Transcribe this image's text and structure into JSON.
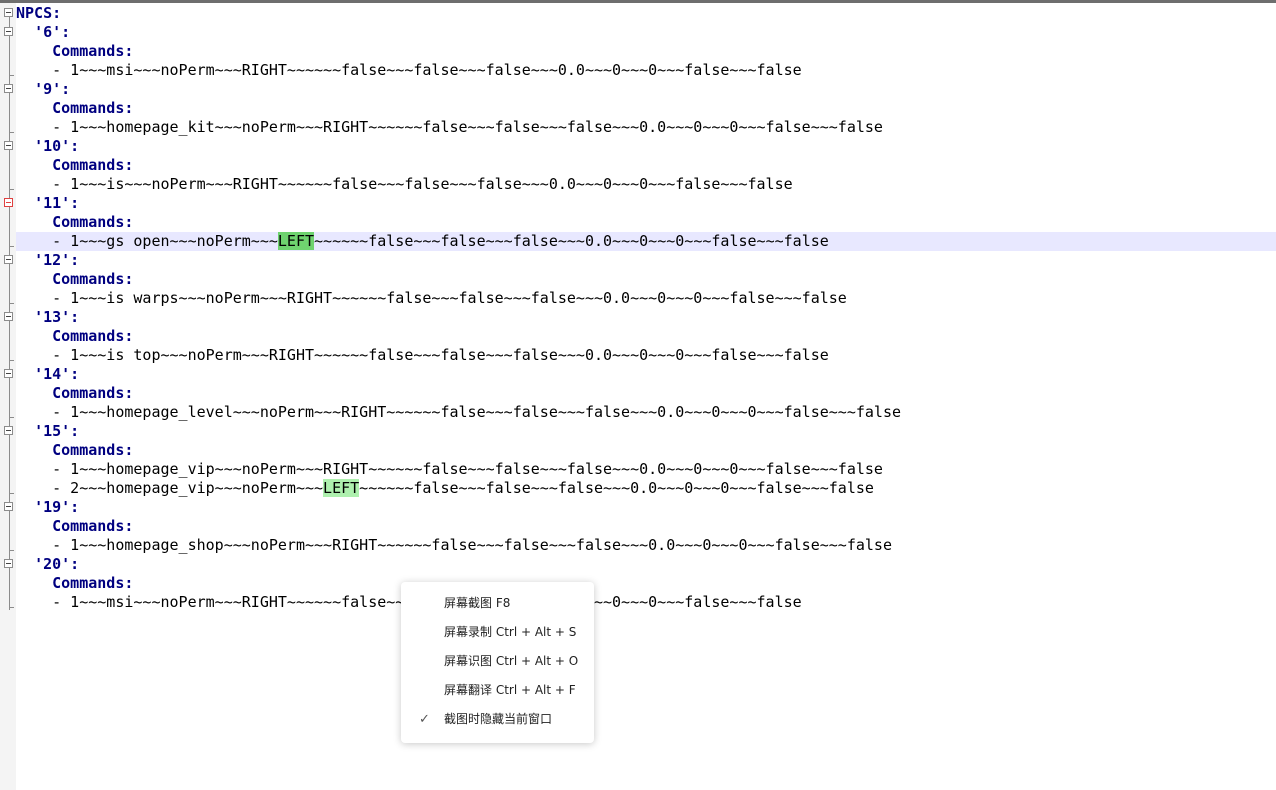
{
  "document": {
    "lines": [
      [
        {
          "t": "NPCS:",
          "c": "key"
        }
      ],
      [
        {
          "t": "  "
        },
        {
          "t": "'6':",
          "c": "key"
        }
      ],
      [
        {
          "t": "    "
        },
        {
          "t": "Commands:",
          "c": "key"
        }
      ],
      [
        {
          "t": "    - 1~~~msi~~~noPerm~~~RIGHT~~~~~~false~~~false~~~false~~~0.0~~~0~~~0~~~false~~~false"
        }
      ],
      [
        {
          "t": "  "
        },
        {
          "t": "'9':",
          "c": "key"
        }
      ],
      [
        {
          "t": "    "
        },
        {
          "t": "Commands:",
          "c": "key"
        }
      ],
      [
        {
          "t": "    - 1~~~homepage_kit~~~noPerm~~~RIGHT~~~~~~false~~~false~~~false~~~0.0~~~0~~~0~~~false~~~false"
        }
      ],
      [
        {
          "t": "  "
        },
        {
          "t": "'10':",
          "c": "key"
        }
      ],
      [
        {
          "t": "    "
        },
        {
          "t": "Commands:",
          "c": "key"
        }
      ],
      [
        {
          "t": "    - 1~~~is~~~noPerm~~~RIGHT~~~~~~false~~~false~~~false~~~0.0~~~0~~~0~~~false~~~false"
        }
      ],
      [
        {
          "t": "  "
        },
        {
          "t": "'11':",
          "c": "key"
        }
      ],
      [
        {
          "t": "    "
        },
        {
          "t": "Commands:",
          "c": "key"
        }
      ],
      [
        {
          "t": "    - 1~~~gs open~~~noPerm~~~"
        },
        {
          "t": "LEFT",
          "c": "hl"
        },
        {
          "t": "~~~~~~false~~~false~~~false~~~0.0~~~0~~~0~~~false~~~false"
        }
      ],
      [
        {
          "t": "  "
        },
        {
          "t": "'12':",
          "c": "key"
        }
      ],
      [
        {
          "t": "    "
        },
        {
          "t": "Commands:",
          "c": "key"
        }
      ],
      [
        {
          "t": "    - 1~~~is warps~~~noPerm~~~RIGHT~~~~~~false~~~false~~~false~~~0.0~~~0~~~0~~~false~~~false"
        }
      ],
      [
        {
          "t": "  "
        },
        {
          "t": "'13':",
          "c": "key"
        }
      ],
      [
        {
          "t": "    "
        },
        {
          "t": "Commands:",
          "c": "key"
        }
      ],
      [
        {
          "t": "    - 1~~~is top~~~noPerm~~~RIGHT~~~~~~false~~~false~~~false~~~0.0~~~0~~~0~~~false~~~false"
        }
      ],
      [
        {
          "t": "  "
        },
        {
          "t": "'14':",
          "c": "key"
        }
      ],
      [
        {
          "t": "    "
        },
        {
          "t": "Commands:",
          "c": "key"
        }
      ],
      [
        {
          "t": "    - 1~~~homepage_level~~~noPerm~~~RIGHT~~~~~~false~~~false~~~false~~~0.0~~~0~~~0~~~false~~~false"
        }
      ],
      [
        {
          "t": "  "
        },
        {
          "t": "'15':",
          "c": "key"
        }
      ],
      [
        {
          "t": "    "
        },
        {
          "t": "Commands:",
          "c": "key"
        }
      ],
      [
        {
          "t": "    - 1~~~homepage_vip~~~noPerm~~~RIGHT~~~~~~false~~~false~~~false~~~0.0~~~0~~~0~~~false~~~false"
        }
      ],
      [
        {
          "t": "    - 2~~~homepage_vip~~~noPerm~~~"
        },
        {
          "t": "LEFT",
          "c": "hl2"
        },
        {
          "t": "~~~~~~false~~~false~~~false~~~0.0~~~0~~~0~~~false~~~false"
        }
      ],
      [
        {
          "t": "  "
        },
        {
          "t": "'19':",
          "c": "key"
        }
      ],
      [
        {
          "t": "    "
        },
        {
          "t": "Commands:",
          "c": "key"
        }
      ],
      [
        {
          "t": "    - 1~~~homepage_shop~~~noPerm~~~RIGHT~~~~~~false~~~false~~~false~~~0.0~~~0~~~0~~~false~~~false"
        }
      ],
      [
        {
          "t": "  "
        },
        {
          "t": "'20':",
          "c": "key"
        }
      ],
      [
        {
          "t": "    "
        },
        {
          "t": "Commands:",
          "c": "key"
        }
      ],
      [
        {
          "t": "    - 1~~~msi~~~noPerm~~~RIGHT~~~~~~false~~~false~~~false~~~0.0~~~0~~~0~~~false~~~false"
        }
      ]
    ],
    "current_line": 12
  },
  "context_menu": {
    "items": [
      {
        "label": "屏幕截图 F8",
        "checked": false
      },
      {
        "label": "屏幕录制 Ctrl + Alt + S",
        "checked": false
      },
      {
        "label": "屏幕识图 Ctrl + Alt + O",
        "checked": false
      },
      {
        "label": "屏幕翻译 Ctrl + Alt + F",
        "checked": false
      },
      {
        "label": "截图时隐藏当前窗口",
        "checked": true
      }
    ]
  },
  "colors": {
    "key": "#000080",
    "highlight": "#6fd36f",
    "highlight_light": "#aef0ae",
    "current_line": "#e8e8ff",
    "fold_marker_active": "#e04040"
  },
  "icons": {
    "fold": "fold-minus-icon",
    "check": "check-icon"
  }
}
